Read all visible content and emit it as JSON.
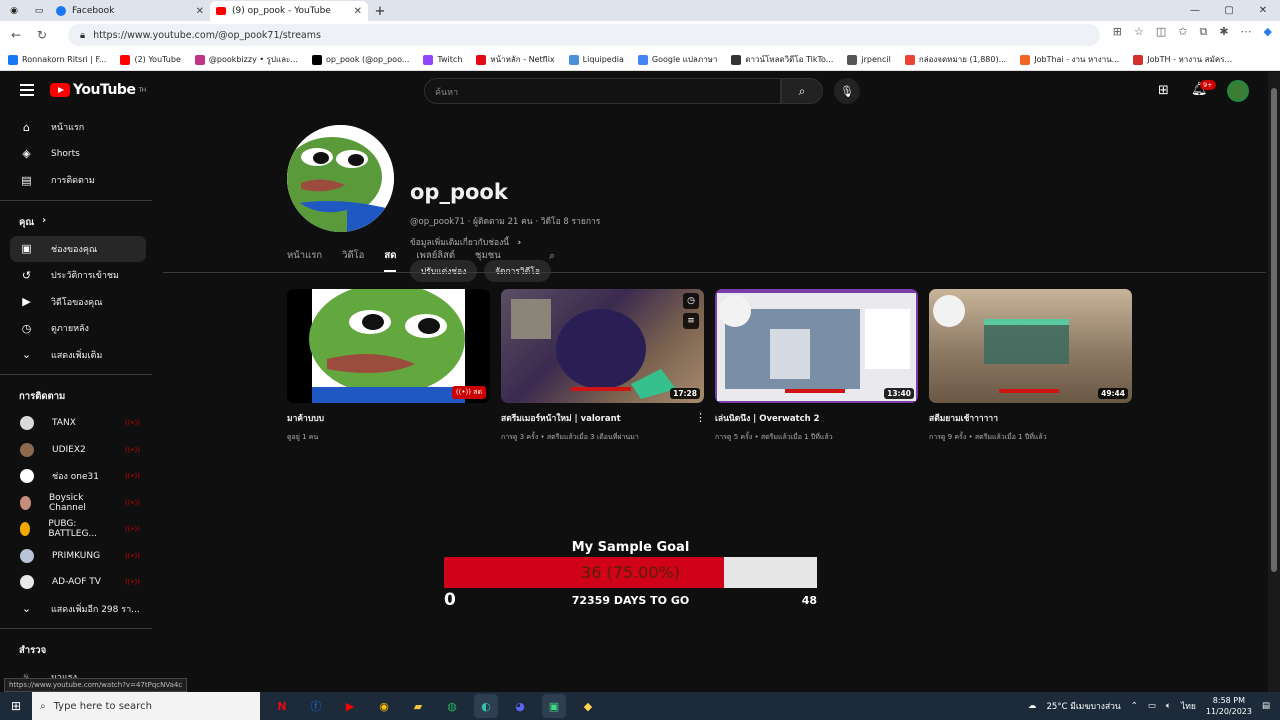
{
  "browser": {
    "tabs": [
      {
        "title": "Facebook",
        "icon_color": "#1877f2"
      },
      {
        "title": "(9) op_pook - YouTube",
        "icon_color": "#ff0000"
      }
    ],
    "url": "https://www.youtube.com/@op_pook71/streams",
    "bookmarks": [
      {
        "label": "Ronnakorn Ritsri | F...",
        "color": "#1877f2"
      },
      {
        "label": "(2) YouTube",
        "color": "#ff0000"
      },
      {
        "label": "@pookbizzy • รูปและ...",
        "color": "#c13584"
      },
      {
        "label": "op_pook (@op_poo...",
        "color": "#000000"
      },
      {
        "label": "Twitch",
        "color": "#9146ff"
      },
      {
        "label": "หน้าหลัก - Netflix",
        "color": "#e50914"
      },
      {
        "label": "Liquipedia",
        "color": "#4a90d9"
      },
      {
        "label": "Google แปลภาษา",
        "color": "#4285f4"
      },
      {
        "label": "ดาวน์โหลดวิดีโอ TikTo...",
        "color": "#333333"
      },
      {
        "label": "jrpencil",
        "color": "#555555"
      },
      {
        "label": "กล่องจดหมาย (1,880)...",
        "color": "#ea4335"
      },
      {
        "label": "JobThai - งาน หางาน...",
        "color": "#f26522"
      },
      {
        "label": "JobTH - หางาน สมัคร...",
        "color": "#d32f2f"
      }
    ]
  },
  "masthead": {
    "logo_text": "YouTube",
    "logo_sup": "TH",
    "search_placeholder": "ค้นหา",
    "notif_count": "9+"
  },
  "sidebar": {
    "main": [
      {
        "label": "หน้าแรก",
        "icon": "home-icon",
        "glyph": "⌂"
      },
      {
        "label": "Shorts",
        "icon": "shorts-icon",
        "glyph": "◈"
      },
      {
        "label": "การติดตาม",
        "icon": "subscriptions-icon",
        "glyph": "▤"
      }
    ],
    "you_heading": "คุณ",
    "you": [
      {
        "label": "ช่องของคุณ",
        "icon": "your-channel-icon",
        "glyph": "▣",
        "active": true
      },
      {
        "label": "ประวัติการเข้าชม",
        "icon": "history-icon",
        "glyph": "↺"
      },
      {
        "label": "วิดีโอของคุณ",
        "icon": "your-videos-icon",
        "glyph": "▶"
      },
      {
        "label": "ดูภายหลัง",
        "icon": "watch-later-icon",
        "glyph": "◷"
      },
      {
        "label": "แสดงเพิ่มเติม",
        "icon": "chevron-down-icon",
        "glyph": "⌄"
      }
    ],
    "subs_heading": "การติดตาม",
    "subscriptions": [
      {
        "label": "TANX",
        "color": "#d9d9d9"
      },
      {
        "label": "UDIEX2",
        "color": "#8b6a4d"
      },
      {
        "label": "ช่อง one31",
        "color": "#ffffff"
      },
      {
        "label": "Boysick Channel",
        "color": "#c98b7a"
      },
      {
        "label": "PUBG: BATTLEG...",
        "color": "#f2a900"
      },
      {
        "label": "PRIMKUNG",
        "color": "#b8c4d6"
      },
      {
        "label": "AD-AOF TV",
        "color": "#e8e8e8"
      }
    ],
    "show_more_subs": "แสดงเพิ่มอีก 298 รา...",
    "explore_heading": "สำรวจ",
    "explore_first": "มาแรง"
  },
  "channel": {
    "name": "op_pook",
    "meta": "@op_pook71 · ผู้ติดตาม 21 คน · วิดีโอ 8 รายการ",
    "more_about": "ข้อมูลเพิ่มเติมเกี่ยวกับช่องนี้",
    "customize_label": "ปรับแต่งช่อง",
    "manage_label": "จัดการวิดีโอ"
  },
  "channel_tabs": [
    {
      "label": "หน้าแรก",
      "active": false
    },
    {
      "label": "วิดีโอ",
      "active": false
    },
    {
      "label": "สด",
      "active": true
    },
    {
      "label": "เพลย์ลิสต์",
      "active": false
    },
    {
      "label": "ชุมชน",
      "active": false
    }
  ],
  "videos": [
    {
      "title": "มาค้าบบบ",
      "meta": "ดูอยู่ 1 คน",
      "badge": "((•)) สด",
      "is_live": true
    },
    {
      "title": "สตรีมเมอร์หน้าใหม่ | valorant",
      "meta": "การดู 3 ครั้ง • สตรีมแล้วเมื่อ 3 เดือนที่ผ่านมา",
      "badge": "17:28",
      "is_live": false
    },
    {
      "title": "เล่นนิดนึง | Overwatch 2",
      "meta": "การดู 5 ครั้ง • สตรีมแล้วเมื่อ 1 ปีที่แล้ว",
      "badge": "13:40",
      "is_live": false
    },
    {
      "title": "สตีมยามเช้าาาาาา",
      "meta": "การดู 9 ครั้ง • สตรีมแล้วเมื่อ 1 ปีที่แล้ว",
      "badge": "49:44",
      "is_live": false
    }
  ],
  "goal": {
    "title": "My Sample Goal",
    "current_label": "36 (75.00%)",
    "progress_fraction": 0.75,
    "min": "0",
    "days_left": "72359 DAYS TO GO",
    "max": "48"
  },
  "status_url": "https://www.youtube.com/watch?v=47tPqcNVa4c",
  "taskbar": {
    "search_placeholder": "Type here to search",
    "weather": "25°C มีเมฆบางส่วน",
    "lang": "ไทย",
    "time": "8:58 PM",
    "date": "11/20/2023"
  }
}
